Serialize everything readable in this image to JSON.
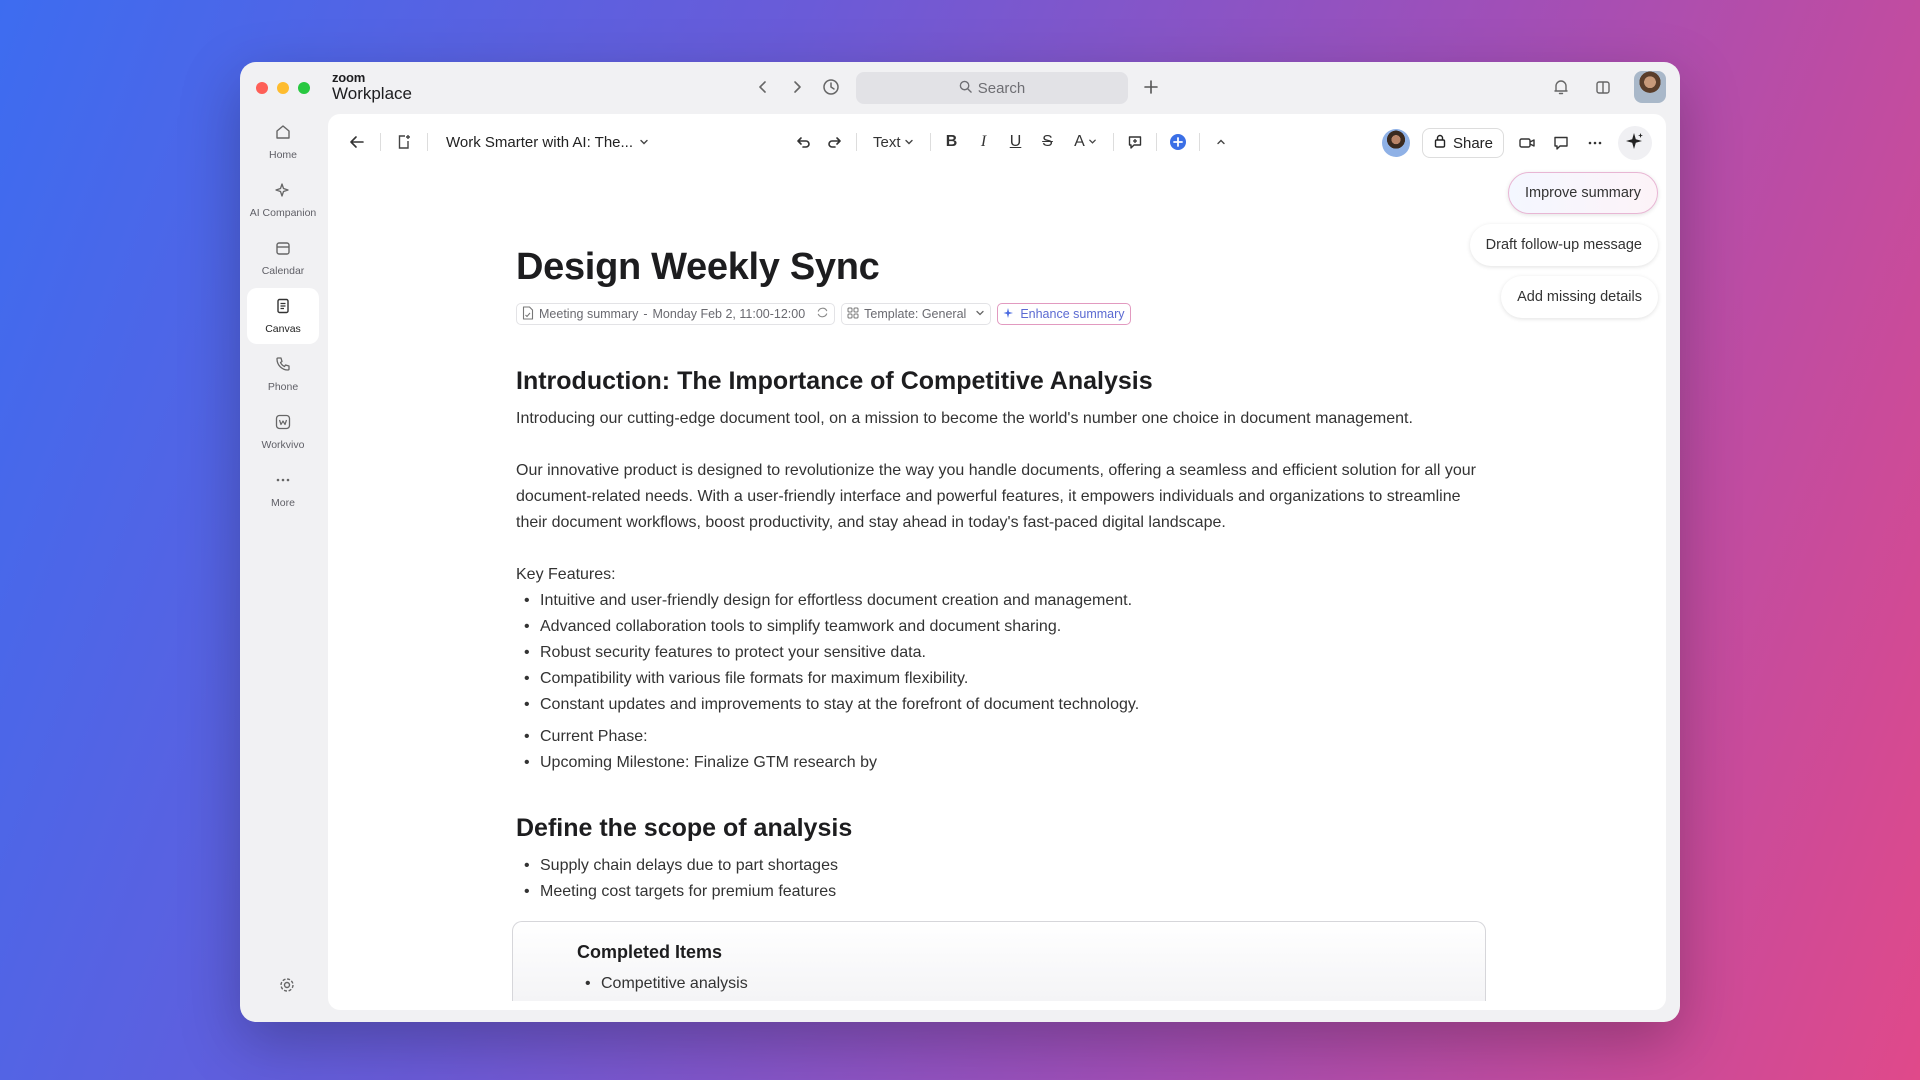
{
  "app": {
    "logo_small": "zoom",
    "logo_big": "Workplace"
  },
  "colors": {
    "close": "#fe5f57",
    "minimize": "#febc2e",
    "zoom": "#28c840",
    "accent": "#3b6fe6"
  },
  "search": {
    "placeholder": "Search"
  },
  "sidebar": {
    "items": [
      {
        "label": "Home",
        "icon": "home-icon"
      },
      {
        "label": "AI Companion",
        "icon": "sparkle-icon"
      },
      {
        "label": "Calendar",
        "icon": "calendar-icon"
      },
      {
        "label": "Canvas",
        "icon": "canvas-icon",
        "active": true
      },
      {
        "label": "Phone",
        "icon": "phone-icon"
      },
      {
        "label": "Workvivo",
        "icon": "workvivo-icon"
      },
      {
        "label": "More",
        "icon": "more-icon"
      }
    ]
  },
  "toolbar": {
    "doc_title": "Work Smarter with AI: The...",
    "text_style": "Text",
    "share_label": "Share"
  },
  "suggestions": [
    "Improve summary",
    "Draft follow-up message",
    "Add missing details"
  ],
  "document": {
    "title": "Design Weekly Sync",
    "meta_summary": "Meeting summary",
    "meta_date": "Monday Feb 2, 11:00-12:00",
    "meta_template": "Template: General",
    "meta_enhance": "Enhance summary",
    "section1_heading": "Introduction: The Importance of Competitive Analysis",
    "para1": "Introducing our cutting-edge document tool, on a mission to become the world's number one choice in document management.",
    "para2": "Our innovative product is designed to revolutionize the way you handle documents, offering a seamless and efficient solution for all your document-related needs. With a user-friendly interface and powerful features, it empowers individuals and organizations to streamline their document workflows, boost productivity, and stay ahead in today's fast-paced digital landscape.",
    "features_label": "Key Features:",
    "features": [
      "Intuitive and user-friendly design for effortless document creation and management.",
      "Advanced collaboration tools to simplify teamwork and document sharing.",
      "Robust security features to protect your sensitive data.",
      "Compatibility with various file formats for maximum flexibility.",
      "Constant updates and improvements to stay at the forefront of document technology."
    ],
    "phase": [
      "Current Phase:",
      "Upcoming Milestone: Finalize GTM research by"
    ],
    "section2_heading": "Define the scope of analysis",
    "scope_items": [
      "Supply chain delays due to part shortages",
      "Meeting cost targets for premium features"
    ],
    "card_title": "Completed Items",
    "card_items": [
      "Competitive analysis"
    ]
  }
}
